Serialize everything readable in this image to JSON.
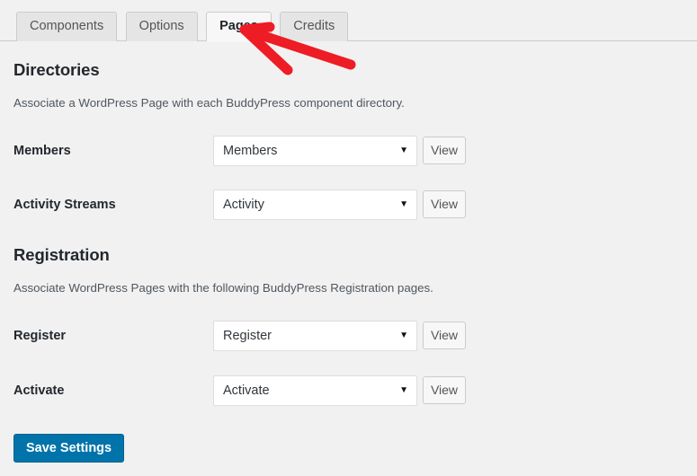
{
  "tabs": [
    {
      "label": "Components",
      "active": false
    },
    {
      "label": "Options",
      "active": false
    },
    {
      "label": "Pages",
      "active": true
    },
    {
      "label": "Credits",
      "active": false
    }
  ],
  "sections": {
    "directories": {
      "title": "Directories",
      "description": "Associate a WordPress Page with each BuddyPress component directory.",
      "rows": [
        {
          "label": "Members",
          "selected": "Members",
          "button": "View"
        },
        {
          "label": "Activity Streams",
          "selected": "Activity",
          "button": "View"
        }
      ]
    },
    "registration": {
      "title": "Registration",
      "description": "Associate WordPress Pages with the following BuddyPress Registration pages.",
      "rows": [
        {
          "label": "Register",
          "selected": "Register",
          "button": "View"
        },
        {
          "label": "Activate",
          "selected": "Activate",
          "button": "View"
        }
      ]
    }
  },
  "save": {
    "label": "Save Settings"
  },
  "icons": {
    "dropdown_arrow": "▼"
  },
  "annotation": {
    "type": "arrow",
    "points_to": "Pages",
    "color": "#ee1c25"
  },
  "colors": {
    "page_background": "#f1f1f1",
    "accent_button": "#0073aa",
    "annotation_red": "#ee1c25",
    "active_tab_background": "#f7f7f7",
    "inactive_tab_background": "#e5e5e5"
  }
}
